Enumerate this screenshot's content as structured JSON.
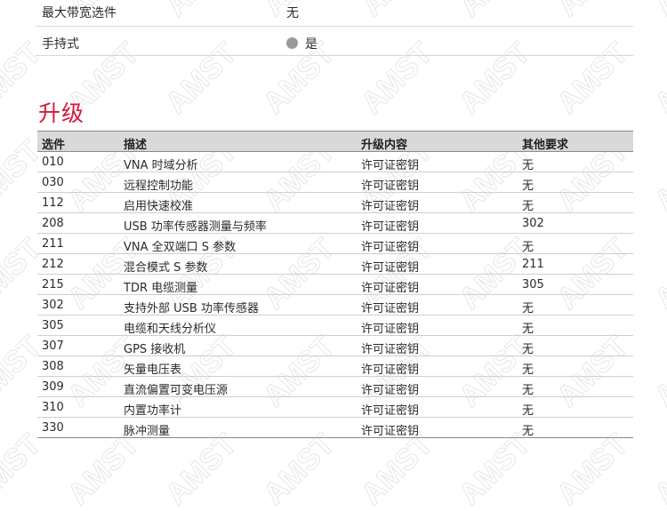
{
  "specs": [
    {
      "label": "最大带宽选件",
      "value": "无",
      "bullet": false
    },
    {
      "label": "手持式",
      "value": "是",
      "bullet": true
    }
  ],
  "section": {
    "title": "升级"
  },
  "upgrades": {
    "headers": [
      "选件",
      "描述",
      "升级内容",
      "其他要求"
    ],
    "rows": [
      [
        "010",
        "VNA 时域分析",
        "许可证密钥",
        "无"
      ],
      [
        "030",
        "远程控制功能",
        "许可证密钥",
        "无"
      ],
      [
        "112",
        "启用快速校准",
        "许可证密钥",
        "无"
      ],
      [
        "208",
        "USB 功率传感器测量与频率",
        "许可证密钥",
        "302"
      ],
      [
        "211",
        "VNA 全双端口 S 参数",
        "许可证密钥",
        "无"
      ],
      [
        "212",
        "混合模式 S 参数",
        "许可证密钥",
        "211"
      ],
      [
        "215",
        "TDR 电缆测量",
        "许可证密钥",
        "305"
      ],
      [
        "302",
        "支持外部 USB 功率传感器",
        "许可证密钥",
        "无"
      ],
      [
        "305",
        "电缆和天线分析仪",
        "许可证密钥",
        "无"
      ],
      [
        "307",
        "GPS 接收机",
        "许可证密钥",
        "无"
      ],
      [
        "308",
        "矢量电压表",
        "许可证密钥",
        "无"
      ],
      [
        "309",
        "直流偏置可变电压源",
        "许可证密钥",
        "无"
      ],
      [
        "310",
        "内置功率计",
        "许可证密钥",
        "无"
      ],
      [
        "330",
        "脉冲测量",
        "许可证密钥",
        "无"
      ]
    ]
  },
  "watermark": {
    "text": "AMST",
    "color": "#e6e6e6"
  }
}
